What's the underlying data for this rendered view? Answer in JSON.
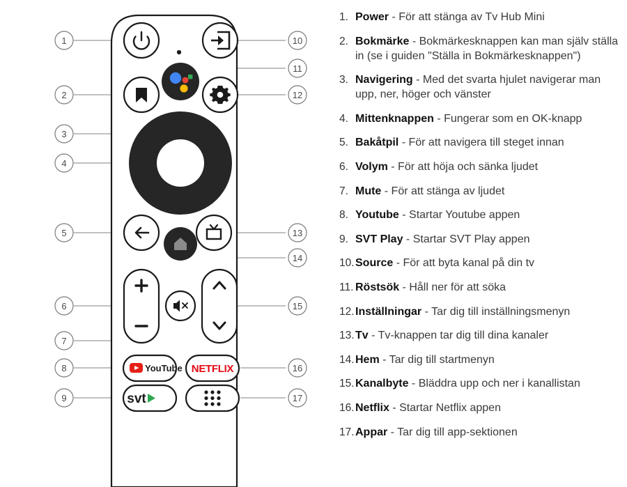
{
  "diagram": {
    "device": "tv-hub-mini-remote",
    "buttons": [
      {
        "id": "power",
        "icon": "power-icon",
        "callout": "1"
      },
      {
        "id": "bookmark",
        "icon": "bookmark-icon",
        "callout": "2"
      },
      {
        "id": "navigation",
        "icon": "nav-wheel-icon",
        "callout": "3"
      },
      {
        "id": "center-ok",
        "icon": "ok-center-icon",
        "callout": "4"
      },
      {
        "id": "back",
        "icon": "back-arrow-icon",
        "callout": "5"
      },
      {
        "id": "volume",
        "icon": "volume-rocker-icon",
        "callout": "6"
      },
      {
        "id": "mute",
        "icon": "mute-icon",
        "callout": "7"
      },
      {
        "id": "youtube",
        "icon": "youtube-icon",
        "callout": "8"
      },
      {
        "id": "svt-play",
        "icon": "svt-play-icon",
        "callout": "9"
      },
      {
        "id": "source",
        "icon": "source-icon",
        "callout": "10"
      },
      {
        "id": "assistant",
        "icon": "google-assistant-icon",
        "callout": "11"
      },
      {
        "id": "settings",
        "icon": "gear-icon",
        "callout": "12"
      },
      {
        "id": "tv",
        "icon": "tv-icon",
        "callout": "13"
      },
      {
        "id": "home",
        "icon": "home-icon",
        "callout": "14"
      },
      {
        "id": "channel",
        "icon": "channel-rocker-icon",
        "callout": "15"
      },
      {
        "id": "netflix",
        "icon": "netflix-icon",
        "callout": "16"
      },
      {
        "id": "apps",
        "icon": "apps-grid-icon",
        "callout": "17"
      }
    ],
    "labels": {
      "youtube": "YouTube",
      "netflix": "NETFLIX",
      "svt": "svt"
    },
    "colors": {
      "body_stroke": "#1a1a1a",
      "dark_fill": "#262626",
      "callout_line": "#9a9a9a",
      "assistant_blue": "#4285F4",
      "assistant_red": "#EA4335",
      "assistant_yellow": "#FBBC05",
      "assistant_green": "#34A853",
      "youtube_red": "#E62117",
      "netflix_red": "#E50914",
      "svt_green": "#2EA84F",
      "home_glyph": "#8a8a8a"
    }
  },
  "legend": {
    "items": [
      {
        "num": "1.",
        "term": "Power",
        "desc": "För att stänga av Tv Hub Mini"
      },
      {
        "num": "2.",
        "term": "Bokmärke",
        "desc": "Bokmärkesknappen kan man själv ställa in (se i guiden \"Ställa in Bokmärkesknappen\")"
      },
      {
        "num": "3.",
        "term": "Navigering",
        "desc": "Med det svarta hjulet navigerar man upp, ner, höger och vänster"
      },
      {
        "num": "4.",
        "term": "Mittenknappen",
        "desc": "Fungerar som en OK-knapp"
      },
      {
        "num": "5.",
        "term": "Bakåtpil",
        "desc": "För att navigera till steget innan"
      },
      {
        "num": "6.",
        "term": "Volym",
        "desc": "För att höja och sänka ljudet"
      },
      {
        "num": "7.",
        "term": "Mute",
        "desc": "För att stänga av ljudet"
      },
      {
        "num": "8.",
        "term": "Youtube",
        "desc": "Startar Youtube appen"
      },
      {
        "num": "9.",
        "term": "SVT Play",
        "desc": "Startar SVT Play appen"
      },
      {
        "num": "10.",
        "term": "Source",
        "desc": "För att byta kanal på din tv"
      },
      {
        "num": "11.",
        "term": "Röstsök",
        "desc": "Håll ner för att söka"
      },
      {
        "num": "12.",
        "term": "Inställningar",
        "desc": "Tar dig till inställningsmenyn"
      },
      {
        "num": "13.",
        "term": "Tv",
        "desc": "Tv-knappen tar dig till dina kanaler"
      },
      {
        "num": "14.",
        "term": "Hem",
        "desc": "Tar dig till startmenyn"
      },
      {
        "num": "15.",
        "term": "Kanalbyte",
        "desc": "Bläddra upp och ner i kanallistan"
      },
      {
        "num": "16.",
        "term": "Netflix",
        "desc": "Startar Netflix appen"
      },
      {
        "num": "17.",
        "term": "Appar",
        "desc": "Tar dig till app-sektionen"
      }
    ],
    "separator": "-"
  }
}
